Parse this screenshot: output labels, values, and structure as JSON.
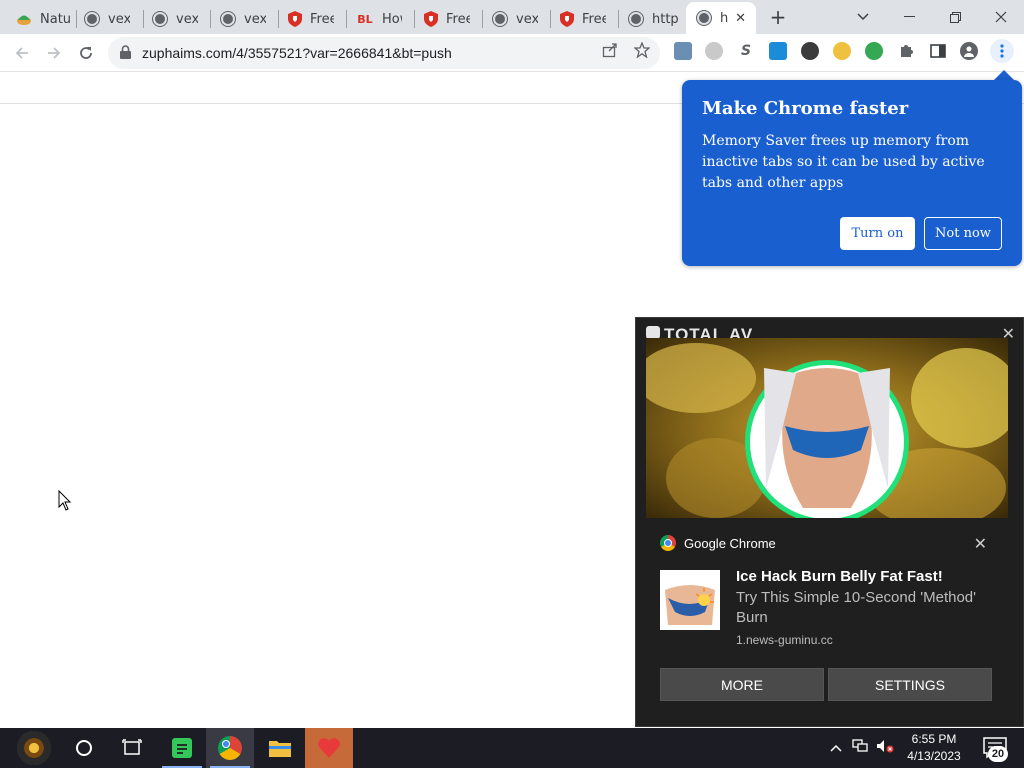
{
  "browser": {
    "tabs": [
      {
        "title": "Natu",
        "favicon": "leaf-icon"
      },
      {
        "title": "vexa",
        "favicon": "globe-icon"
      },
      {
        "title": "vexa",
        "favicon": "globe-icon"
      },
      {
        "title": "vexa",
        "favicon": "globe-icon"
      },
      {
        "title": "Free",
        "favicon": "shield-icon"
      },
      {
        "title": "How",
        "favicon": "bl-icon",
        "favicon_text": "BL"
      },
      {
        "title": "Free",
        "favicon": "shield-icon"
      },
      {
        "title": "vexa",
        "favicon": "globe-icon"
      },
      {
        "title": "Free",
        "favicon": "shield-icon"
      },
      {
        "title": "http",
        "favicon": "globe-icon"
      },
      {
        "title": "h",
        "favicon": "globe-icon",
        "active": true
      }
    ],
    "new_tab_label": "+",
    "url": "zuphaims.com/4/3557521?var=2666841&bt=push",
    "extensions": [
      "extension-1-icon",
      "extension-2-icon",
      "extension-s-icon",
      "extension-4-icon",
      "extension-5-icon",
      "extension-6-icon",
      "extension-7-icon",
      "puzzle-icon",
      "side-panel-icon",
      "profile-icon",
      "menu-icon"
    ],
    "extension_s_label": "S"
  },
  "bubble": {
    "title": "Make Chrome faster",
    "body": "Memory Saver frees up memory from inactive tabs so it can be used by active tabs and other apps",
    "primary_button": "Turn on",
    "secondary_button": "Not now",
    "color": "#1a5fd0"
  },
  "notification": {
    "brand": "TOTAL AV",
    "app_name": "Google Chrome",
    "title": "Ice Hack Burn Belly Fat Fast!",
    "text": "Try This Simple 10-Second 'Method' Burn",
    "source": "1.news-guminu.cc",
    "buttons": {
      "more": "MORE",
      "settings": "SETTINGS"
    },
    "close_glyph": "✕"
  },
  "taskbar": {
    "clock_time": "6:55 PM",
    "clock_date": "4/13/2023",
    "notification_count": "20",
    "pinned": [
      "start-orb-icon",
      "cortana-icon",
      "task-view-icon",
      "notes-app-icon",
      "chrome-icon",
      "file-explorer-icon",
      "heart-app-icon"
    ]
  }
}
